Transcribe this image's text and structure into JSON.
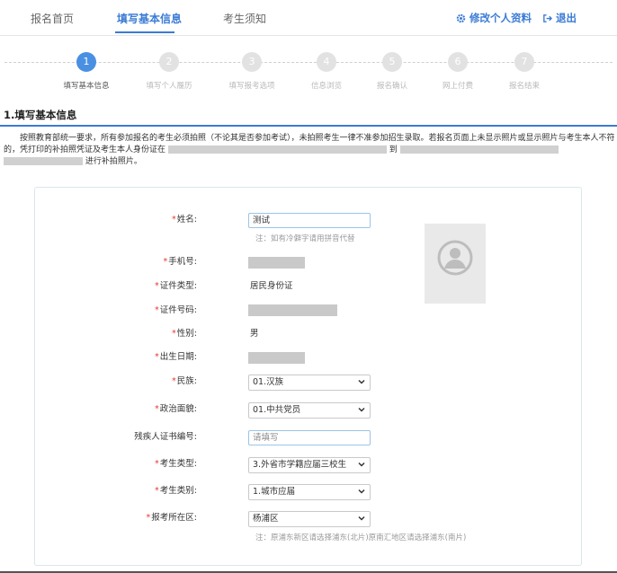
{
  "nav": {
    "tabs": [
      {
        "label": "报名首页"
      },
      {
        "label": "填写基本信息"
      },
      {
        "label": "考生须知"
      }
    ],
    "edit_profile": "修改个人资料",
    "logout": "退出"
  },
  "steps": [
    {
      "num": "1",
      "label": "填写基本信息"
    },
    {
      "num": "2",
      "label": "填写个人履历"
    },
    {
      "num": "3",
      "label": "填写报考选项"
    },
    {
      "num": "4",
      "label": "信息浏览"
    },
    {
      "num": "5",
      "label": "报名确认"
    },
    {
      "num": "6",
      "label": "网上付费"
    },
    {
      "num": "7",
      "label": "报名结束"
    }
  ],
  "section": {
    "title": "1.填写基本信息"
  },
  "notice": {
    "part1": "按照教育部统一要求，所有参加报名的考生必须拍照（不论其是否参加考试），未拍照考生一律不准参加招生录取。若报名页面上未显示照片或显示照片与考生本人不符的，凭打印的补拍照凭证及考生本人身份证在",
    "part2": "到",
    "part3": "进行补拍照片。"
  },
  "form": {
    "name": {
      "label": "姓名:",
      "value": "测试",
      "hint": "注：如有冷僻字请用拼音代替"
    },
    "phone": {
      "label": "手机号:"
    },
    "id_type": {
      "label": "证件类型:",
      "value": "居民身份证"
    },
    "id_number": {
      "label": "证件号码:"
    },
    "gender": {
      "label": "性别:",
      "value": "男"
    },
    "birth": {
      "label": "出生日期:"
    },
    "ethnicity": {
      "label": "民族:",
      "value": "01.汉族"
    },
    "political": {
      "label": "政治面貌:",
      "value": "01.中共党员"
    },
    "disability": {
      "label": "残疾人证书编号:",
      "placeholder": "请填写"
    },
    "candidate_type": {
      "label": "考生类型:",
      "value": "3.外省市学籍应届三校生"
    },
    "candidate_category": {
      "label": "考生类别:",
      "value": "1.城市应届"
    },
    "district": {
      "label": "报考所在区:",
      "value": "杨浦区",
      "hint": "注：原浦东新区请选择浦东(北片)原南汇地区请选择浦东(南片)"
    },
    "required_mark": "*"
  },
  "colors": {
    "accent": "#3a7bd5",
    "required": "#e53935"
  }
}
